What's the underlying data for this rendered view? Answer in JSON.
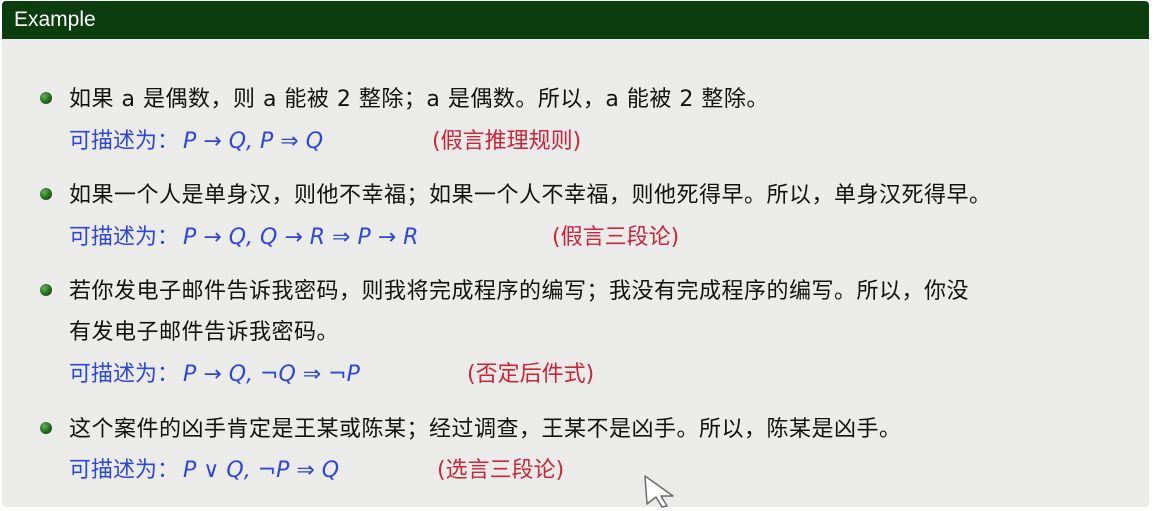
{
  "block": {
    "title": "Example",
    "colors": {
      "header_bg": "#0b3d0e",
      "body_bg": "#ebecea",
      "text": "#111111",
      "formula": "#2f47d6",
      "rule": "#c8263a"
    }
  },
  "items": [
    {
      "text_lines": [
        "如果 a 是偶数，则 a 能被 2 整除；a 是偶数。所以，a 能被 2 整除。"
      ],
      "formula_label": "可描述为：",
      "formula": "P → Q, P ⇒ Q",
      "rule": "(假言推理规则)"
    },
    {
      "text_lines": [
        "如果一个人是单身汉，则他不幸福；如果一个人不幸福，则他死得早。所以，单身汉死得早。"
      ],
      "formula_label": "可描述为：",
      "formula": "P → Q, Q → R ⇒ P → R",
      "rule": "(假言三段论)"
    },
    {
      "text_lines": [
        "若你发电子邮件告诉我密码，则我将完成程序的编写；我没有完成程序的编写。所以，你没",
        "有发电子邮件告诉我密码。"
      ],
      "formula_label": "可描述为：",
      "formula": "P → Q, ¬Q ⇒ ¬P",
      "rule": "(否定后件式)"
    },
    {
      "text_lines": [
        "这个案件的凶手肯定是王某或陈某；经过调查，王某不是凶手。所以，陈某是凶手。"
      ],
      "formula_label": "可描述为：",
      "formula": "P ∨ Q, ¬P ⇒ Q",
      "rule": "(选言三段论)"
    }
  ],
  "cursor": {
    "icon": "mouse-pointer-icon"
  }
}
